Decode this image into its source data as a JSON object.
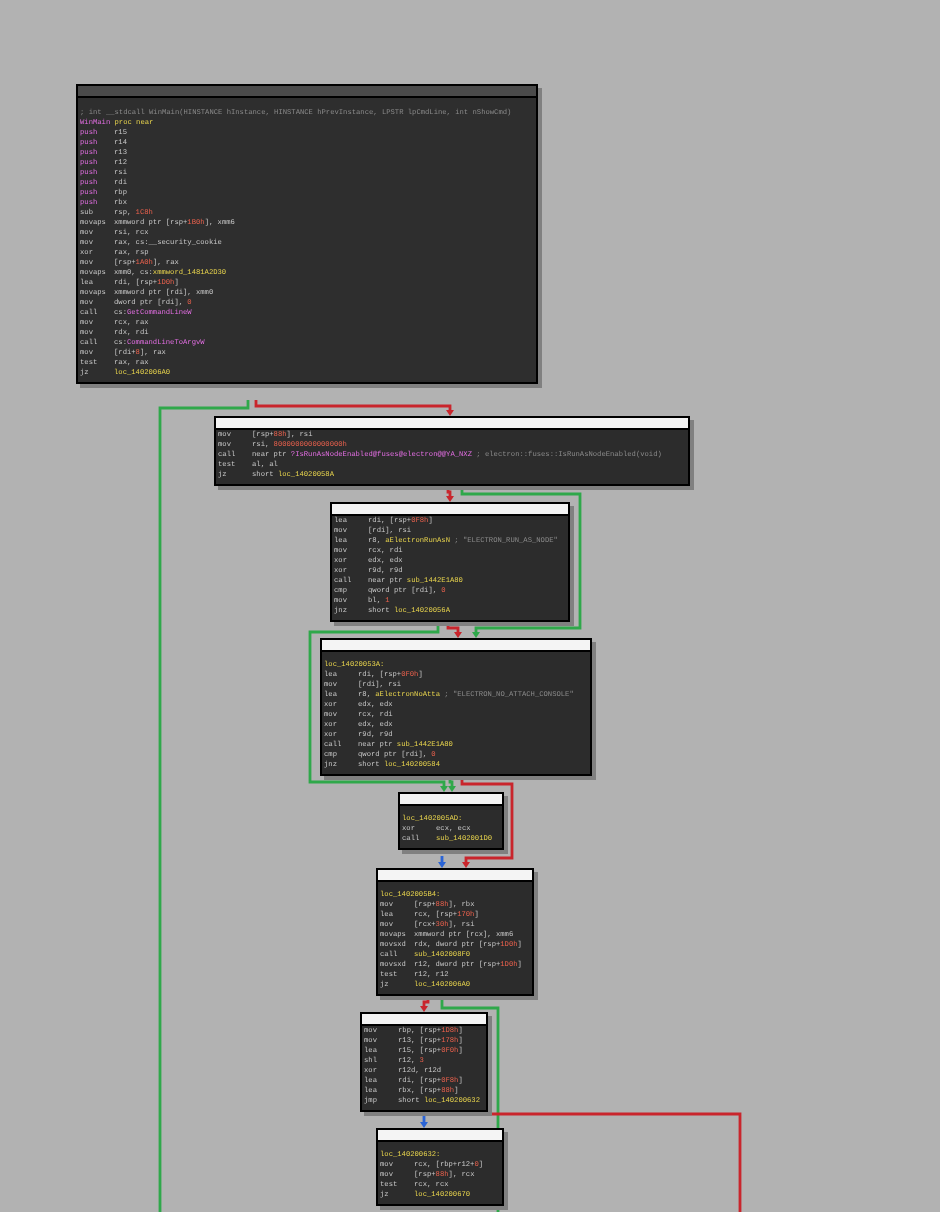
{
  "blocks": [
    {
      "kind": "function_start",
      "lines": [
        {
          "label": [
            {
              "text": "; int __stdcall WinMain(HINSTANCE hInstance, HINSTANCE hPrevInstance, LPSTR lpCmdLine, int nShowCmd)",
              "kind": "cmt"
            }
          ]
        },
        {
          "label": [
            {
              "text": "WinMain",
              "kind": "func"
            },
            {
              "text": " proc near",
              "kind": "name"
            }
          ]
        },
        {
          "op": {
            "text": "push",
            "kind": "hl"
          },
          "args": [
            {
              "text": "r15",
              "kind": "reg"
            }
          ]
        },
        {
          "op": {
            "text": "push",
            "kind": "hl"
          },
          "args": [
            {
              "text": "r14",
              "kind": "reg"
            }
          ]
        },
        {
          "op": {
            "text": "push",
            "kind": "hl"
          },
          "args": [
            {
              "text": "r13",
              "kind": "reg"
            }
          ]
        },
        {
          "op": {
            "text": "push",
            "kind": "hl"
          },
          "args": [
            {
              "text": "r12",
              "kind": "reg"
            }
          ]
        },
        {
          "op": {
            "text": "push",
            "kind": "hl"
          },
          "args": [
            {
              "text": "rsi",
              "kind": "reg"
            }
          ]
        },
        {
          "op": {
            "text": "push",
            "kind": "hl"
          },
          "args": [
            {
              "text": "rdi",
              "kind": "reg"
            }
          ]
        },
        {
          "op": {
            "text": "push",
            "kind": "hl"
          },
          "args": [
            {
              "text": "rbp",
              "kind": "reg"
            }
          ]
        },
        {
          "op": {
            "text": "push",
            "kind": "hl"
          },
          "args": [
            {
              "text": "rbx",
              "kind": "reg"
            }
          ]
        },
        {
          "op": {
            "text": "sub",
            "kind": "plain"
          },
          "args": [
            {
              "text": "rsp, ",
              "kind": "reg"
            },
            {
              "text": "1C8h",
              "kind": "num"
            }
          ]
        },
        {
          "op": {
            "text": "movaps",
            "kind": "plain"
          },
          "args": [
            {
              "text": "xmmword ptr [rsp+",
              "kind": "reg"
            },
            {
              "text": "1B0h",
              "kind": "num"
            },
            {
              "text": "], xmm6",
              "kind": "reg"
            }
          ]
        },
        {
          "op": {
            "text": "mov",
            "kind": "plain"
          },
          "args": [
            {
              "text": "rsi, rcx",
              "kind": "reg"
            }
          ]
        },
        {
          "op": {
            "text": "mov",
            "kind": "plain"
          },
          "args": [
            {
              "text": "rax, cs:__security_cookie",
              "kind": "reg"
            }
          ]
        },
        {
          "op": {
            "text": "xor",
            "kind": "plain"
          },
          "args": [
            {
              "text": "rax, rsp",
              "kind": "reg"
            }
          ]
        },
        {
          "op": {
            "text": "mov",
            "kind": "plain"
          },
          "args": [
            {
              "text": "[rsp+",
              "kind": "reg"
            },
            {
              "text": "1A0h",
              "kind": "num"
            },
            {
              "text": "], rax",
              "kind": "reg"
            }
          ]
        },
        {
          "op": {
            "text": "movaps",
            "kind": "plain"
          },
          "args": [
            {
              "text": "xmm0, cs:",
              "kind": "reg"
            },
            {
              "text": "xmmword_1481A2D30",
              "kind": "name"
            }
          ]
        },
        {
          "op": {
            "text": "lea",
            "kind": "plain"
          },
          "args": [
            {
              "text": "rdi, [rsp+",
              "kind": "reg"
            },
            {
              "text": "1D0h",
              "kind": "num"
            },
            {
              "text": "]",
              "kind": "reg"
            }
          ]
        },
        {
          "op": {
            "text": "movaps",
            "kind": "plain"
          },
          "args": [
            {
              "text": "xmmword ptr [rdi], xmm0",
              "kind": "reg"
            }
          ]
        },
        {
          "op": {
            "text": "mov",
            "kind": "plain"
          },
          "args": [
            {
              "text": "dword ptr [rdi], ",
              "kind": "reg"
            },
            {
              "text": "0",
              "kind": "num"
            }
          ]
        },
        {
          "op": {
            "text": "call",
            "kind": "plain"
          },
          "args": [
            {
              "text": "cs:",
              "kind": "reg"
            },
            {
              "text": "GetCommandLineW",
              "kind": "func"
            }
          ]
        },
        {
          "op": {
            "text": "mov",
            "kind": "plain"
          },
          "args": [
            {
              "text": "rcx, rax",
              "kind": "reg"
            }
          ]
        },
        {
          "op": {
            "text": "mov",
            "kind": "plain"
          },
          "args": [
            {
              "text": "rdx, rdi",
              "kind": "reg"
            }
          ]
        },
        {
          "op": {
            "text": "call",
            "kind": "plain"
          },
          "args": [
            {
              "text": "cs:",
              "kind": "reg"
            },
            {
              "text": "CommandLineToArgvW",
              "kind": "func"
            }
          ]
        },
        {
          "op": {
            "text": "mov",
            "kind": "plain"
          },
          "args": [
            {
              "text": "[rdi+",
              "kind": "reg"
            },
            {
              "text": "8",
              "kind": "num"
            },
            {
              "text": "], rax",
              "kind": "reg"
            }
          ]
        },
        {
          "op": {
            "text": "test",
            "kind": "plain"
          },
          "args": [
            {
              "text": "rax, rax",
              "kind": "reg"
            }
          ]
        },
        {
          "op": {
            "text": "jz",
            "kind": "plain"
          },
          "args": [
            {
              "text": "loc_1402006A0",
              "kind": "name"
            }
          ]
        }
      ]
    },
    {
      "kind": "basic_block",
      "lines": [
        {
          "op": {
            "text": "mov",
            "kind": "plain"
          },
          "args": [
            {
              "text": "[rsp+",
              "kind": "reg"
            },
            {
              "text": "88h",
              "kind": "num"
            },
            {
              "text": "], rsi",
              "kind": "reg"
            }
          ]
        },
        {
          "op": {
            "text": "mov",
            "kind": "plain"
          },
          "args": [
            {
              "text": "rsi, ",
              "kind": "reg"
            },
            {
              "text": "8000000000000000h",
              "kind": "num"
            }
          ]
        },
        {
          "op": {
            "text": "call",
            "kind": "plain"
          },
          "args": [
            {
              "text": "near ptr ",
              "kind": "reg"
            },
            {
              "text": "?IsRunAsNodeEnabled@fuses@electron@@YA_NXZ",
              "kind": "func"
            },
            {
              "text": " ; electron::fuses::IsRunAsNodeEnabled(void)",
              "kind": "cmt"
            }
          ]
        },
        {
          "op": {
            "text": "test",
            "kind": "plain"
          },
          "args": [
            {
              "text": "al, al",
              "kind": "reg"
            }
          ]
        },
        {
          "op": {
            "text": "jz",
            "kind": "plain"
          },
          "args": [
            {
              "text": "short ",
              "kind": "reg"
            },
            {
              "text": "loc_14020058A",
              "kind": "name"
            }
          ]
        }
      ]
    },
    {
      "kind": "basic_block",
      "lines": [
        {
          "op": {
            "text": "lea",
            "kind": "plain"
          },
          "args": [
            {
              "text": "rdi, [rsp+",
              "kind": "reg"
            },
            {
              "text": "0F8h",
              "kind": "num"
            },
            {
              "text": "]",
              "kind": "reg"
            }
          ]
        },
        {
          "op": {
            "text": "mov",
            "kind": "plain"
          },
          "args": [
            {
              "text": "[rdi], rsi",
              "kind": "reg"
            }
          ]
        },
        {
          "op": {
            "text": "lea",
            "kind": "plain"
          },
          "args": [
            {
              "text": "r8, ",
              "kind": "reg"
            },
            {
              "text": "aElectronRunAsN",
              "kind": "name"
            },
            {
              "text": " ; \"ELECTRON_RUN_AS_NODE\"",
              "kind": "cmt"
            }
          ]
        },
        {
          "op": {
            "text": "mov",
            "kind": "plain"
          },
          "args": [
            {
              "text": "rcx, rdi",
              "kind": "reg"
            }
          ]
        },
        {
          "op": {
            "text": "xor",
            "kind": "plain"
          },
          "args": [
            {
              "text": "edx, edx",
              "kind": "reg"
            }
          ]
        },
        {
          "op": {
            "text": "xor",
            "kind": "plain"
          },
          "args": [
            {
              "text": "r9d, r9d",
              "kind": "reg"
            }
          ]
        },
        {
          "op": {
            "text": "call",
            "kind": "plain"
          },
          "args": [
            {
              "text": "near ptr ",
              "kind": "reg"
            },
            {
              "text": "sub_1442E1A80",
              "kind": "name"
            }
          ]
        },
        {
          "op": {
            "text": "cmp",
            "kind": "plain"
          },
          "args": [
            {
              "text": "qword ptr [rdi], ",
              "kind": "reg"
            },
            {
              "text": "0",
              "kind": "num"
            }
          ]
        },
        {
          "op": {
            "text": "mov",
            "kind": "plain"
          },
          "args": [
            {
              "text": "bl, ",
              "kind": "reg"
            },
            {
              "text": "1",
              "kind": "num"
            }
          ]
        },
        {
          "op": {
            "text": "jnz",
            "kind": "plain"
          },
          "args": [
            {
              "text": "short ",
              "kind": "reg"
            },
            {
              "text": "loc_14020056A",
              "kind": "name"
            }
          ]
        }
      ]
    },
    {
      "kind": "labeled_block",
      "lines": [
        {
          "label": [
            {
              "text": "loc_14020053A:",
              "kind": "name"
            }
          ]
        },
        {
          "op": {
            "text": "lea",
            "kind": "plain"
          },
          "args": [
            {
              "text": "rdi, [rsp+",
              "kind": "reg"
            },
            {
              "text": "0F0h",
              "kind": "num"
            },
            {
              "text": "]",
              "kind": "reg"
            }
          ]
        },
        {
          "op": {
            "text": "mov",
            "kind": "plain"
          },
          "args": [
            {
              "text": "[rdi], rsi",
              "kind": "reg"
            }
          ]
        },
        {
          "op": {
            "text": "lea",
            "kind": "plain"
          },
          "args": [
            {
              "text": "r8, ",
              "kind": "reg"
            },
            {
              "text": "aElectronNoAtta",
              "kind": "name"
            },
            {
              "text": " ; \"ELECTRON_NO_ATTACH_CONSOLE\"",
              "kind": "cmt"
            }
          ]
        },
        {
          "op": {
            "text": "xor",
            "kind": "plain"
          },
          "args": [
            {
              "text": "edx, edx",
              "kind": "reg"
            }
          ]
        },
        {
          "op": {
            "text": "mov",
            "kind": "plain"
          },
          "args": [
            {
              "text": "rcx, rdi",
              "kind": "reg"
            }
          ]
        },
        {
          "op": {
            "text": "xor",
            "kind": "plain"
          },
          "args": [
            {
              "text": "edx, edx",
              "kind": "reg"
            }
          ]
        },
        {
          "op": {
            "text": "xor",
            "kind": "plain"
          },
          "args": [
            {
              "text": "r9d, r9d",
              "kind": "reg"
            }
          ]
        },
        {
          "op": {
            "text": "call",
            "kind": "plain"
          },
          "args": [
            {
              "text": "near ptr ",
              "kind": "reg"
            },
            {
              "text": "sub_1442E1A80",
              "kind": "name"
            }
          ]
        },
        {
          "op": {
            "text": "cmp",
            "kind": "plain"
          },
          "args": [
            {
              "text": "qword ptr [rdi], ",
              "kind": "reg"
            },
            {
              "text": "0",
              "kind": "num"
            }
          ]
        },
        {
          "op": {
            "text": "jnz",
            "kind": "plain"
          },
          "args": [
            {
              "text": "short ",
              "kind": "reg"
            },
            {
              "text": "loc_140200584",
              "kind": "name"
            }
          ]
        }
      ]
    },
    {
      "kind": "labeled_block",
      "lines": [
        {
          "label": [
            {
              "text": "loc_1402005AD:",
              "kind": "name"
            }
          ]
        },
        {
          "op": {
            "text": "xor",
            "kind": "plain"
          },
          "args": [
            {
              "text": "ecx, ecx",
              "kind": "reg"
            }
          ]
        },
        {
          "op": {
            "text": "call",
            "kind": "plain"
          },
          "args": [
            {
              "text": "sub_1402001D0",
              "kind": "name"
            }
          ]
        }
      ]
    },
    {
      "kind": "labeled_block",
      "lines": [
        {
          "label": [
            {
              "text": "loc_1402005B4:",
              "kind": "name"
            }
          ]
        },
        {
          "op": {
            "text": "mov",
            "kind": "plain"
          },
          "args": [
            {
              "text": "[rsp+",
              "kind": "reg"
            },
            {
              "text": "88h",
              "kind": "num"
            },
            {
              "text": "], rbx",
              "kind": "reg"
            }
          ]
        },
        {
          "op": {
            "text": "lea",
            "kind": "plain"
          },
          "args": [
            {
              "text": "rcx, [rsp+",
              "kind": "reg"
            },
            {
              "text": "170h",
              "kind": "num"
            },
            {
              "text": "]",
              "kind": "reg"
            }
          ]
        },
        {
          "op": {
            "text": "mov",
            "kind": "plain"
          },
          "args": [
            {
              "text": "[rcx+",
              "kind": "reg"
            },
            {
              "text": "30h",
              "kind": "num"
            },
            {
              "text": "], rsi",
              "kind": "reg"
            }
          ]
        },
        {
          "op": {
            "text": "movaps",
            "kind": "plain"
          },
          "args": [
            {
              "text": "xmmword ptr [rcx], xmm6",
              "kind": "reg"
            }
          ]
        },
        {
          "op": {
            "text": "movsxd",
            "kind": "plain"
          },
          "args": [
            {
              "text": "rdx, dword ptr [rsp+",
              "kind": "reg"
            },
            {
              "text": "1D0h",
              "kind": "num"
            },
            {
              "text": "]",
              "kind": "reg"
            }
          ]
        },
        {
          "op": {
            "text": "call",
            "kind": "plain"
          },
          "args": [
            {
              "text": "sub_1402008F0",
              "kind": "name"
            }
          ]
        },
        {
          "op": {
            "text": "movsxd",
            "kind": "plain"
          },
          "args": [
            {
              "text": "r12, dword ptr [rsp+",
              "kind": "reg"
            },
            {
              "text": "1D0h",
              "kind": "num"
            },
            {
              "text": "]",
              "kind": "reg"
            }
          ]
        },
        {
          "op": {
            "text": "test",
            "kind": "plain"
          },
          "args": [
            {
              "text": "r12, r12",
              "kind": "reg"
            }
          ]
        },
        {
          "op": {
            "text": "jz",
            "kind": "plain"
          },
          "args": [
            {
              "text": "loc_1402006A0",
              "kind": "name"
            }
          ]
        }
      ]
    },
    {
      "kind": "basic_block",
      "lines": [
        {
          "op": {
            "text": "mov",
            "kind": "plain"
          },
          "args": [
            {
              "text": "rbp, [rsp+",
              "kind": "reg"
            },
            {
              "text": "1D8h",
              "kind": "num"
            },
            {
              "text": "]",
              "kind": "reg"
            }
          ]
        },
        {
          "op": {
            "text": "mov",
            "kind": "plain"
          },
          "args": [
            {
              "text": "r13, [rsp+",
              "kind": "reg"
            },
            {
              "text": "178h",
              "kind": "num"
            },
            {
              "text": "]",
              "kind": "reg"
            }
          ]
        },
        {
          "op": {
            "text": "lea",
            "kind": "plain"
          },
          "args": [
            {
              "text": "r15, [rsp+",
              "kind": "reg"
            },
            {
              "text": "0F0h",
              "kind": "num"
            },
            {
              "text": "]",
              "kind": "reg"
            }
          ]
        },
        {
          "op": {
            "text": "shl",
            "kind": "plain"
          },
          "args": [
            {
              "text": "r12, ",
              "kind": "reg"
            },
            {
              "text": "3",
              "kind": "num"
            }
          ]
        },
        {
          "op": {
            "text": "xor",
            "kind": "plain"
          },
          "args": [
            {
              "text": "r12d, r12d",
              "kind": "reg"
            }
          ]
        },
        {
          "op": {
            "text": "lea",
            "kind": "plain"
          },
          "args": [
            {
              "text": "rdi, [rsp+",
              "kind": "reg"
            },
            {
              "text": "0F8h",
              "kind": "num"
            },
            {
              "text": "]",
              "kind": "reg"
            }
          ]
        },
        {
          "op": {
            "text": "lea",
            "kind": "plain"
          },
          "args": [
            {
              "text": "rbx, [rsp+",
              "kind": "reg"
            },
            {
              "text": "88h",
              "kind": "num"
            },
            {
              "text": "]",
              "kind": "reg"
            }
          ]
        },
        {
          "op": {
            "text": "jmp",
            "kind": "plain"
          },
          "args": [
            {
              "text": "short ",
              "kind": "reg"
            },
            {
              "text": "loc_140200632",
              "kind": "name"
            }
          ]
        }
      ]
    },
    {
      "kind": "labeled_block",
      "lines": [
        {
          "label": [
            {
              "text": "loc_140200632:",
              "kind": "name"
            }
          ]
        },
        {
          "op": {
            "text": "mov",
            "kind": "plain"
          },
          "args": [
            {
              "text": "rcx, [rbp+r12+",
              "kind": "reg"
            },
            {
              "text": "0",
              "kind": "num"
            },
            {
              "text": "]",
              "kind": "reg"
            }
          ]
        },
        {
          "op": {
            "text": "mov",
            "kind": "plain"
          },
          "args": [
            {
              "text": "[rsp+",
              "kind": "reg"
            },
            {
              "text": "88h",
              "kind": "num"
            },
            {
              "text": "], rcx",
              "kind": "reg"
            }
          ]
        },
        {
          "op": {
            "text": "test",
            "kind": "plain"
          },
          "args": [
            {
              "text": "rcx, rcx",
              "kind": "reg"
            }
          ]
        },
        {
          "op": {
            "text": "jz",
            "kind": "plain"
          },
          "args": [
            {
              "text": "loc_140200670",
              "kind": "name"
            }
          ]
        }
      ]
    }
  ],
  "edges": [
    {
      "kind": "not_taken"
    },
    {
      "kind": "taken"
    },
    {
      "kind": "not_taken"
    },
    {
      "kind": "taken"
    },
    {
      "kind": "not_taken"
    },
    {
      "kind": "taken"
    },
    {
      "kind": "taken"
    },
    {
      "kind": "not_taken"
    },
    {
      "kind": "unconditional"
    },
    {
      "kind": "not_taken"
    },
    {
      "kind": "taken"
    },
    {
      "kind": "unconditional"
    },
    {
      "kind": "not_taken"
    }
  ]
}
